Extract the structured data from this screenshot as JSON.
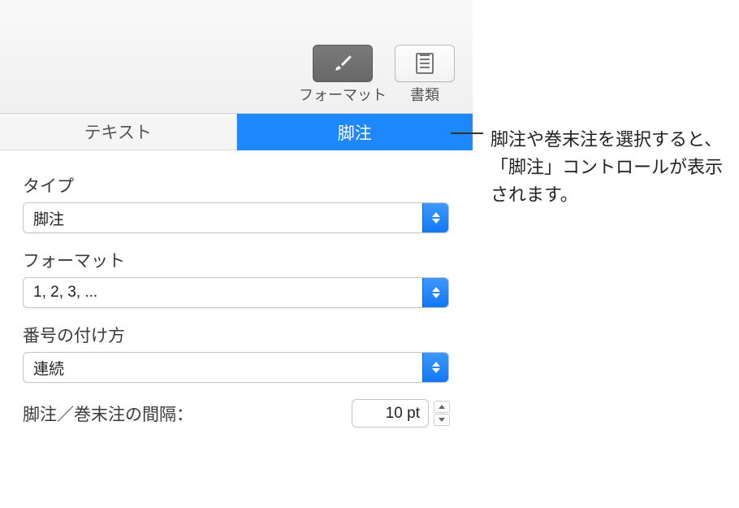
{
  "toolbar": {
    "items": [
      {
        "label": "フォーマット",
        "active": true
      },
      {
        "label": "書類",
        "active": false
      }
    ]
  },
  "tabs": [
    {
      "label": "テキスト",
      "active": false
    },
    {
      "label": "脚注",
      "active": true
    }
  ],
  "fields": {
    "type": {
      "label": "タイプ",
      "value": "脚注"
    },
    "format": {
      "label": "フォーマット",
      "value": "1, 2, 3, ..."
    },
    "numbering": {
      "label": "番号の付け方",
      "value": "連続"
    },
    "spacing": {
      "label": "脚注／巻末注の間隔：",
      "value": "10 pt"
    }
  },
  "callout": {
    "text": "脚注や巻末注を選択すると、「脚注」コントロールが表示されます。"
  }
}
